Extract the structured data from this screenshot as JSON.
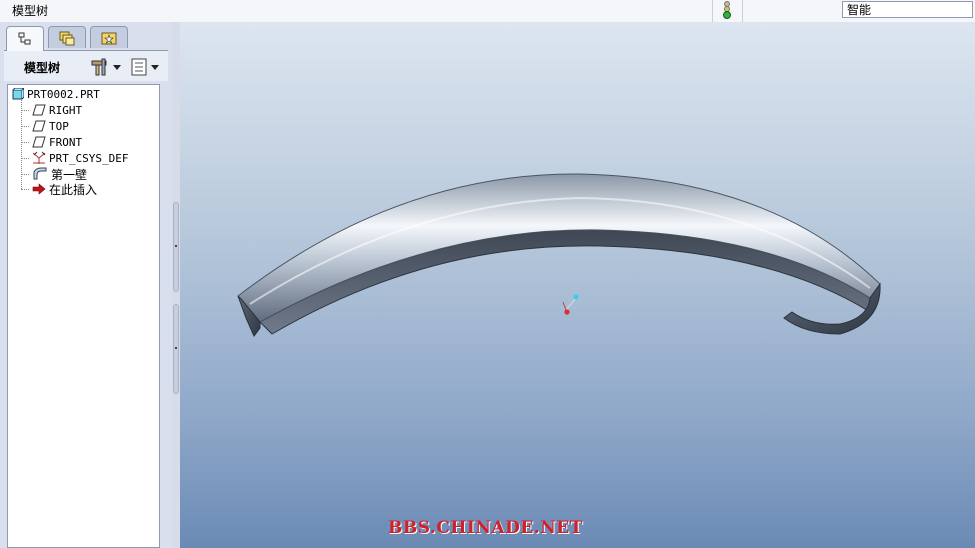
{
  "window": {
    "title": "模型树"
  },
  "status": {
    "filter_value": "智能"
  },
  "left_panel": {
    "tabs": [
      {
        "name": "model-tree-tab",
        "icon": "tree-structure-icon",
        "active": true
      },
      {
        "name": "folder-browser-tab",
        "icon": "folders-icon",
        "active": false
      },
      {
        "name": "favorites-tab",
        "icon": "star-folder-icon",
        "active": false
      }
    ],
    "header_label": "模型树",
    "settings_icon": "tools-settings-icon",
    "show_icon": "list-show-icon"
  },
  "model_tree": {
    "items": [
      {
        "label": "PRT0002.PRT",
        "icon": "part-icon"
      },
      {
        "label": "RIGHT",
        "icon": "datum-plane-icon"
      },
      {
        "label": "TOP",
        "icon": "datum-plane-icon"
      },
      {
        "label": "FRONT",
        "icon": "datum-plane-icon"
      },
      {
        "label": "PRT_CSYS_DEF",
        "icon": "coordinate-system-icon"
      },
      {
        "label": "第一壁",
        "icon": "sheetmetal-wall-icon"
      },
      {
        "label": "在此插入",
        "icon": "insert-here-arrow-icon"
      }
    ]
  },
  "viewport": {
    "model": "curved-tube-model",
    "watermark": "BBS.CHINADE.NET"
  },
  "colors": {
    "viewport_top": "#dde6f0",
    "viewport_bottom": "#6a8ab5",
    "watermark": "#d0202a"
  }
}
